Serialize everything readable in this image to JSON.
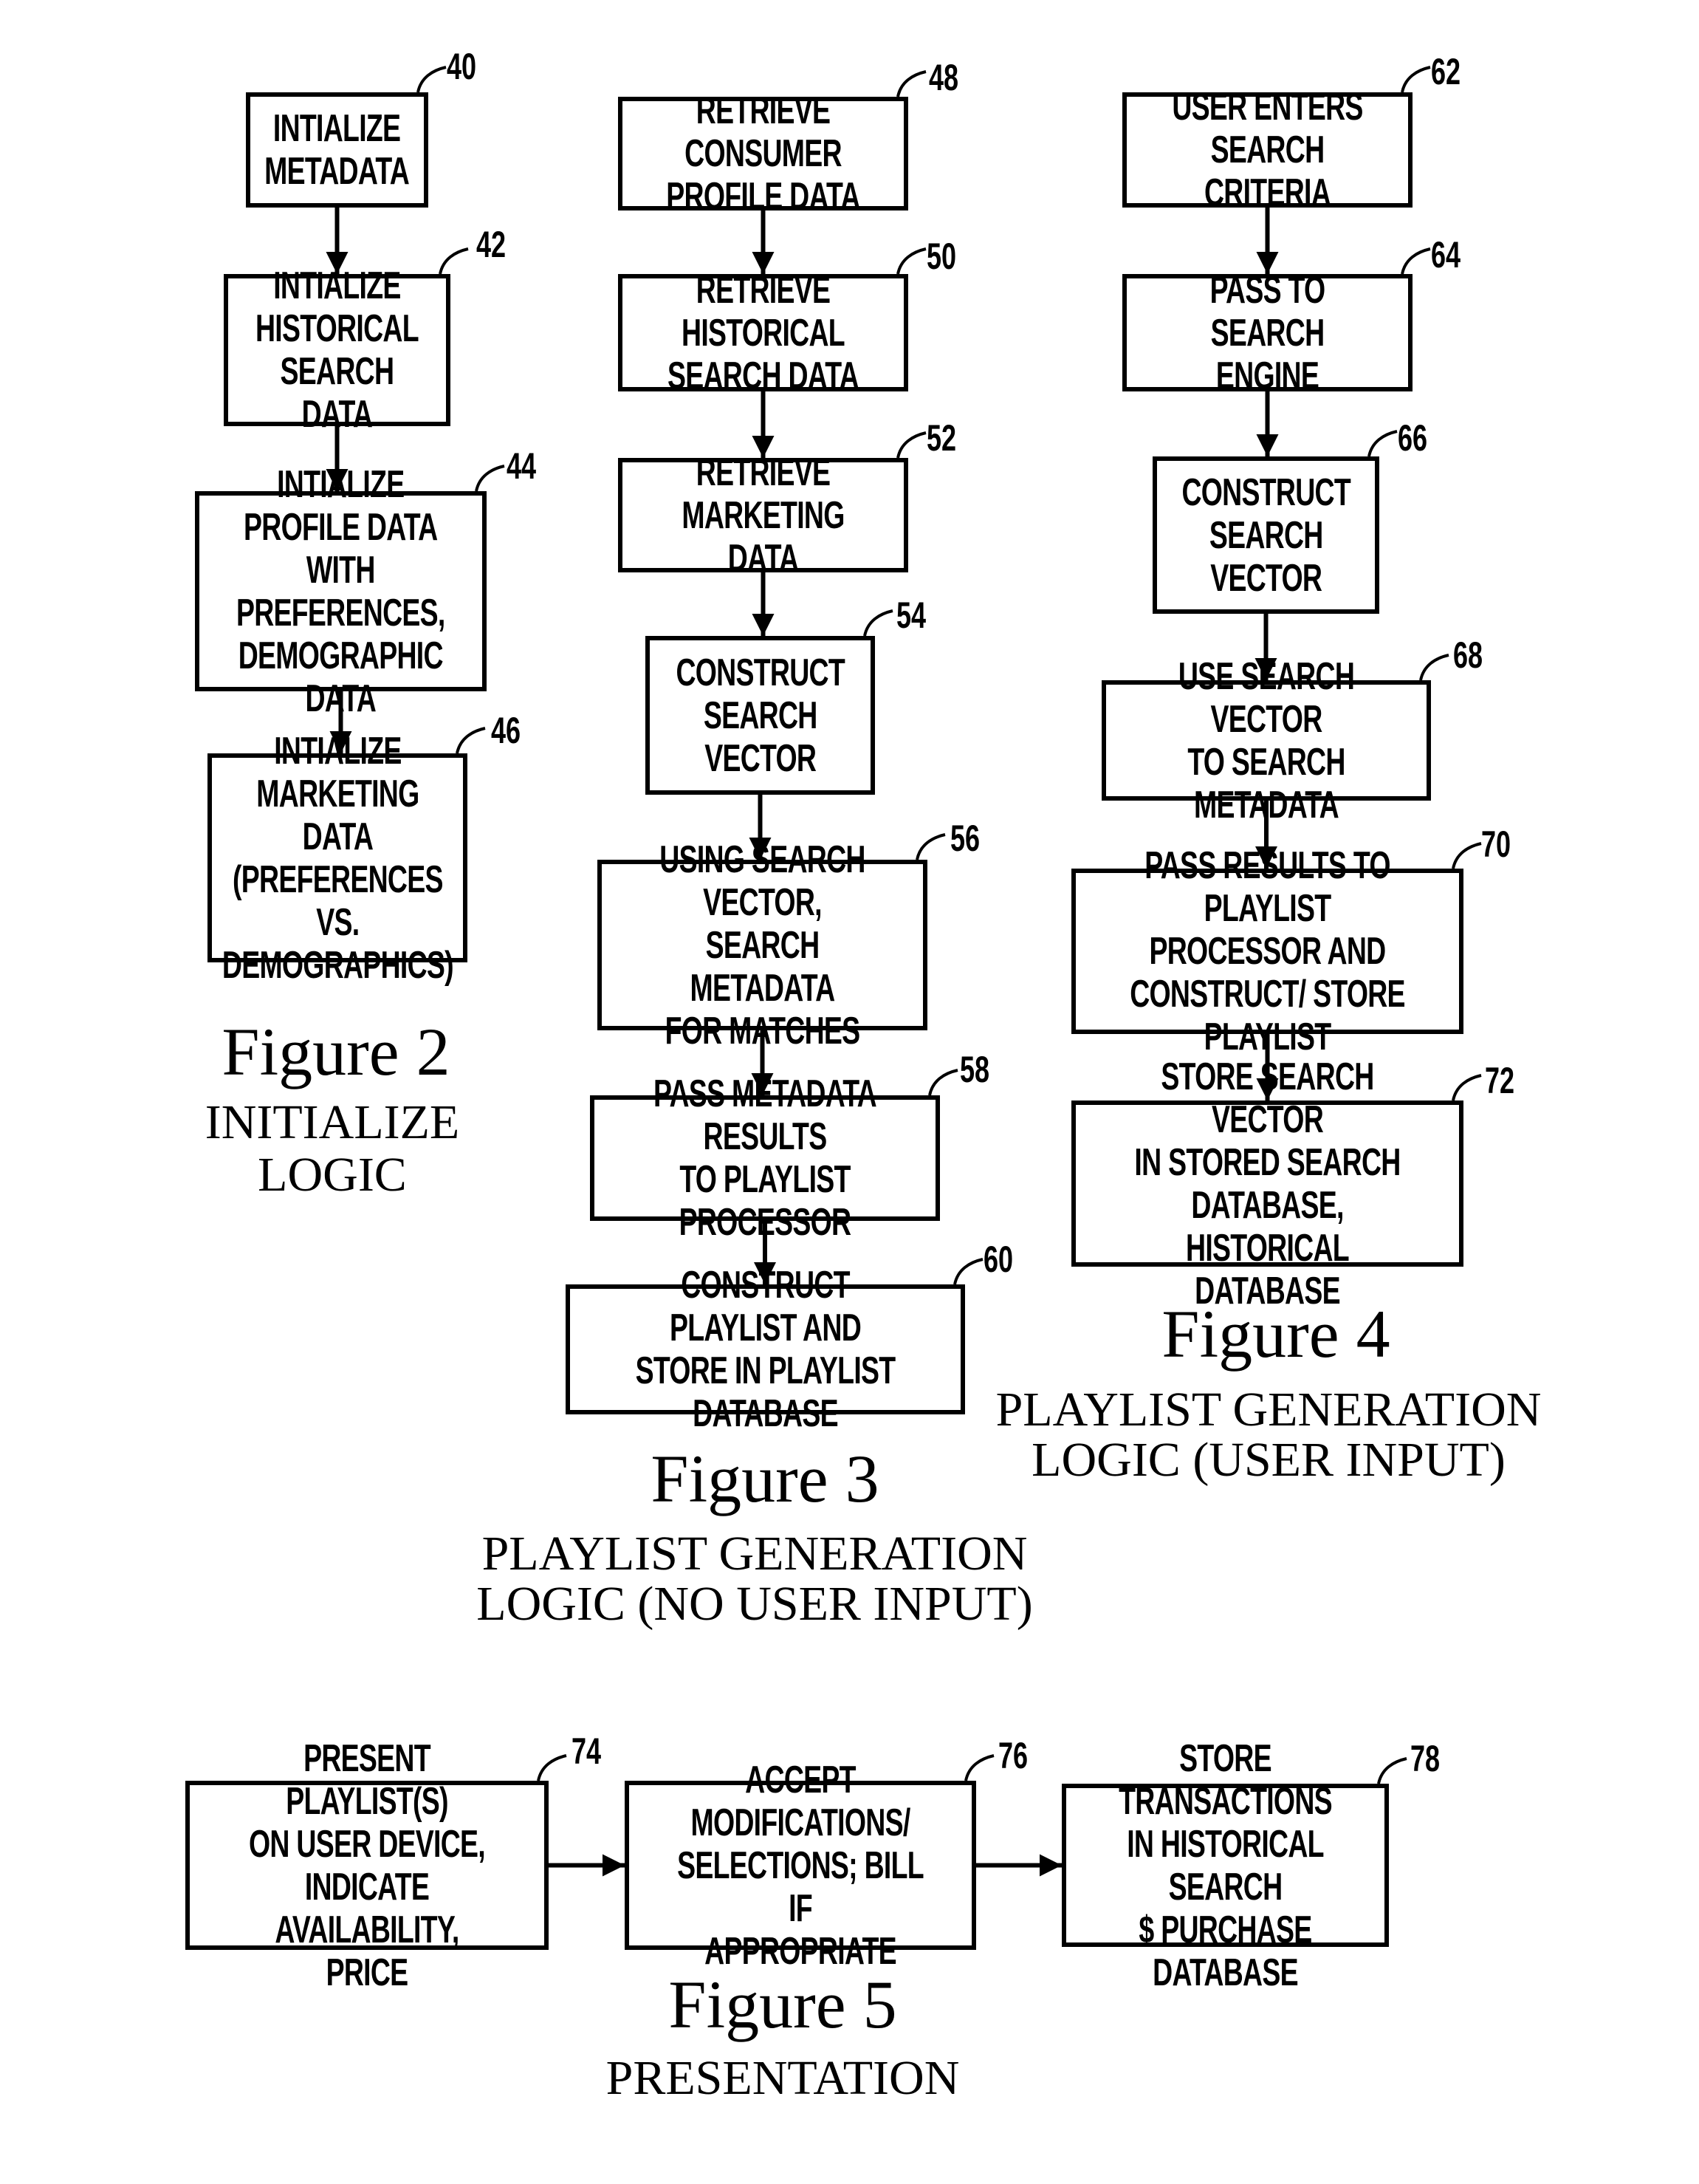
{
  "figures": {
    "fig2": {
      "title": "Figure 2",
      "subtitle_lines": [
        "INITIALIZE",
        "LOGIC"
      ],
      "steps": [
        {
          "ref": "40",
          "text": "INTIALIZE\nMETADATA"
        },
        {
          "ref": "42",
          "text": "INTIALIZE\nHISTORICAL\nSEARCH DATA"
        },
        {
          "ref": "44",
          "text": "INTIALIZE\nPROFILE DATA\nWITH PREFERENCES,\nDEMOGRAPHIC DATA"
        },
        {
          "ref": "46",
          "text": "INTIALIZE\nMARKETING DATA\n(PREFERENCES VS.\nDEMOGRAPHICS)"
        }
      ]
    },
    "fig3": {
      "title": "Figure 3",
      "subtitle_lines": [
        "PLAYLIST GENERATION",
        "LOGIC (NO USER INPUT)"
      ],
      "steps": [
        {
          "ref": "48",
          "text": "RETRIEVE CONSUMER\nPROFILE DATA"
        },
        {
          "ref": "50",
          "text": "RETRIEVE HISTORICAL\nSEARCH DATA"
        },
        {
          "ref": "52",
          "text": "RETRIEVE\nMARKETING DATA"
        },
        {
          "ref": "54",
          "text": "CONSTRUCT\nSEARCH\nVECTOR"
        },
        {
          "ref": "56",
          "text": "USING SEARCH VECTOR,\nSEARCH METADATA\nFOR MATCHES"
        },
        {
          "ref": "58",
          "text": "PASS METADATA RESULTS\nTO PLAYLIST PROCESSOR"
        },
        {
          "ref": "60",
          "text": "CONSTRUCT PLAYLIST AND\nSTORE IN PLAYLIST DATABASE"
        }
      ]
    },
    "fig4": {
      "title": "Figure 4",
      "subtitle_lines": [
        "PLAYLIST GENERATION",
        "LOGIC (USER INPUT)"
      ],
      "steps": [
        {
          "ref": "62",
          "text": "USER ENTERS\nSEARCH CRITERIA"
        },
        {
          "ref": "64",
          "text": "PASS TO SEARCH\nENGINE"
        },
        {
          "ref": "66",
          "text": "CONSTRUCT\nSEARCH\nVECTOR"
        },
        {
          "ref": "68",
          "text": "USE SEARCH VECTOR\nTO SEARCH METADATA"
        },
        {
          "ref": "70",
          "text": "PASS RESULTS TO PLAYLIST\nPROCESSOR AND\nCONSTRUCT/ STORE PLAYLIST"
        },
        {
          "ref": "72",
          "text": "STORE SEARCH VECTOR\nIN STORED SEARCH DATABASE,\nHISTORICAL DATABASE"
        }
      ]
    },
    "fig5": {
      "title": "Figure 5",
      "subtitle_lines": [
        "PRESENTATION"
      ],
      "steps": [
        {
          "ref": "74",
          "text": "PRESENT PLAYLIST(S)\nON USER DEVICE, INDICATE\nAVAILABILITY, PRICE"
        },
        {
          "ref": "76",
          "text": "ACCEPT MODIFICATIONS/\nSELECTIONS; BILL IF\nAPPROPRIATE"
        },
        {
          "ref": "78",
          "text": "STORE TRANSACTIONS\nIN HISTORICAL SEARCH\n$ PURCHASE DATABASE"
        }
      ]
    }
  }
}
